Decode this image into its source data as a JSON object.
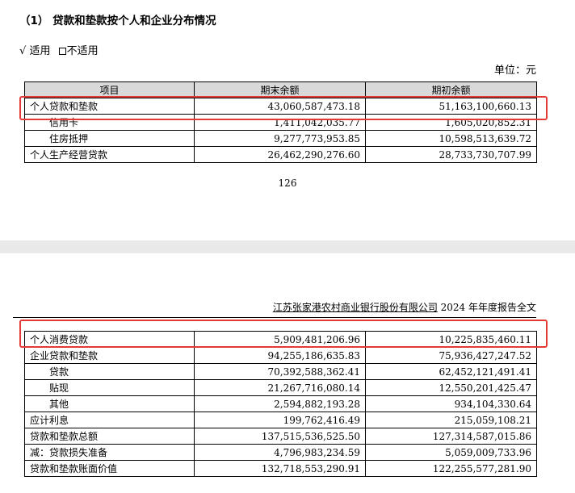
{
  "section_title": "（1） 贷款和垫款按个人和企业分布情况",
  "applicability": {
    "checked_mark": "√",
    "applicable": "适用",
    "not_applicable": "不适用"
  },
  "unit": "单位：元",
  "table_top": {
    "headers": [
      "项目",
      "期末余额",
      "期初余额"
    ],
    "rows": [
      {
        "label": "个人贷款和垫款",
        "end": "43,060,587,473.18",
        "begin": "51,163,100,660.13"
      },
      {
        "label": "信用卡",
        "end": "1,411,042,035.77",
        "begin": "1,605,020,852.31"
      },
      {
        "label": "住房抵押",
        "end": "9,277,773,953.85",
        "begin": "10,598,513,639.72"
      },
      {
        "label": "个人生产经营贷款",
        "end": "26,462,290,276.60",
        "begin": "28,733,730,707.99"
      }
    ]
  },
  "page_number": "126",
  "report_header": {
    "company": "江苏张家港农村商业银行股份有限公司",
    "suffix": " 2024 年年度报告全文"
  },
  "table_bottom": {
    "rows": [
      {
        "label": "个人消费贷款",
        "end": "5,909,481,206.96",
        "begin": "10,225,835,460.11"
      },
      {
        "label": "企业贷款和垫款",
        "end": "94,255,186,635.83",
        "begin": "75,936,427,247.52"
      },
      {
        "label": "贷款",
        "end": "70,392,588,362.41",
        "begin": "62,452,121,491.41"
      },
      {
        "label": "贴现",
        "end": "21,267,716,080.14",
        "begin": "12,550,201,425.47"
      },
      {
        "label": "其他",
        "end": "2,594,882,193.28",
        "begin": "934,104,330.64"
      },
      {
        "label": "应计利息",
        "end": "199,762,416.49",
        "begin": "215,059,108.21"
      },
      {
        "label": "贷款和垫款总额",
        "end": "137,515,536,525.50",
        "begin": "127,314,587,015.86"
      },
      {
        "label": "减：贷款损失准备",
        "end": "4,796,983,234.59",
        "begin": "5,059,009,733.96"
      },
      {
        "label": "贷款和垫款账面价值",
        "end": "132,718,553,290.91",
        "begin": "122,255,577,281.90"
      }
    ]
  },
  "highlight_color": "#e53935"
}
